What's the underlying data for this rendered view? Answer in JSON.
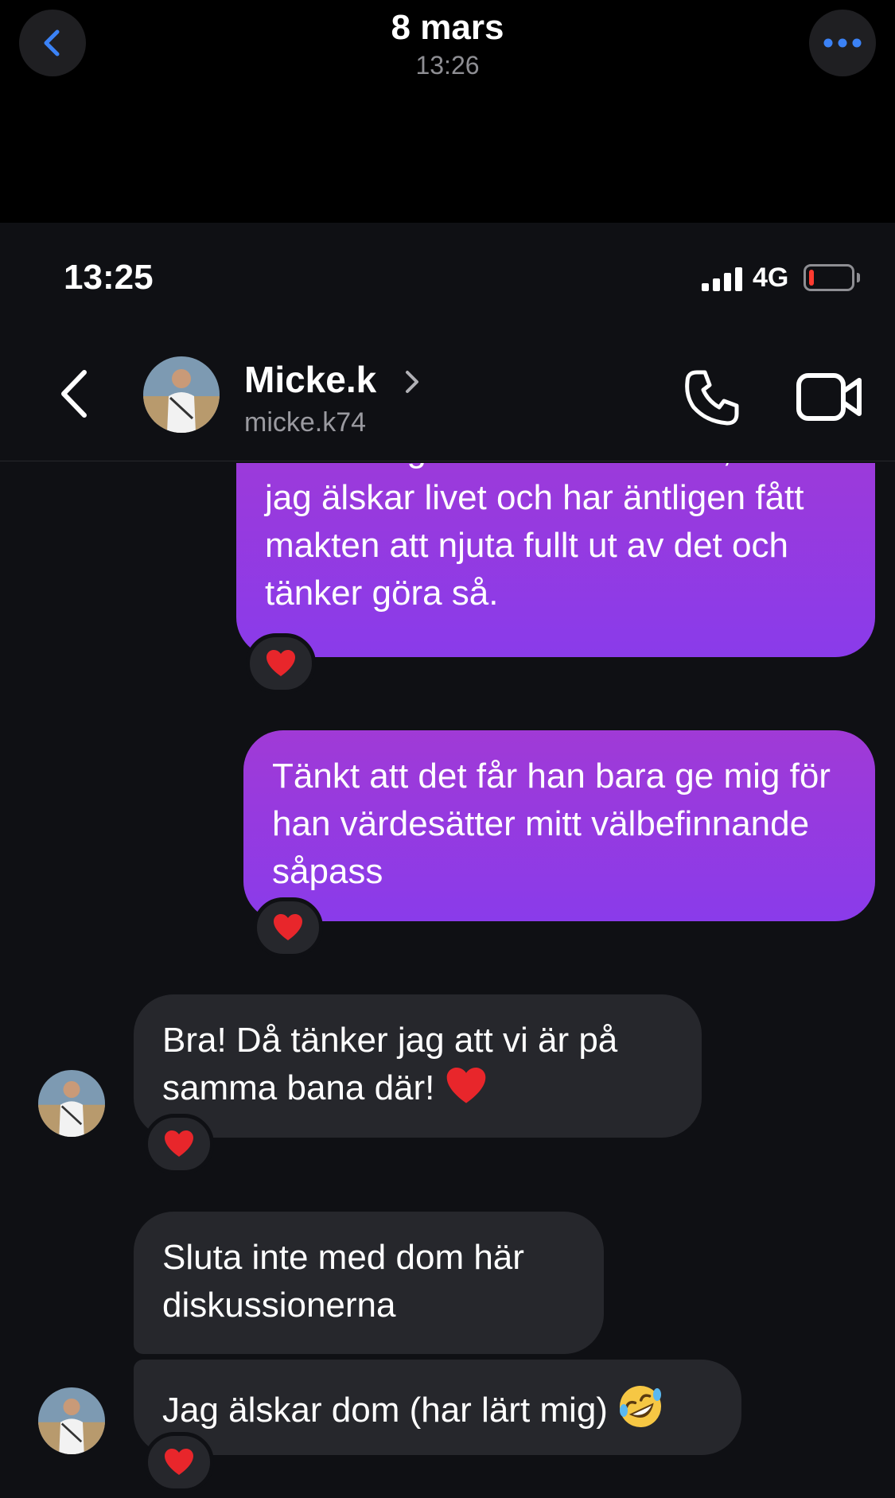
{
  "viewer": {
    "date": "8 mars",
    "time": "13:26",
    "back_icon": "chevron-left-icon",
    "more_icon": "ellipsis-icon"
  },
  "status_bar": {
    "time": "13:25",
    "network": "4G",
    "battery_level": 0.12
  },
  "chat_header": {
    "name": "Micke.k",
    "handle": "micke.k74"
  },
  "messages": [
    {
      "direction": "sent",
      "text": "omständigheter som situation, men jag älskar livet och har äntligen fått makten att njuta fullt ut av det och tänker göra så.",
      "reaction": "heart"
    },
    {
      "direction": "sent",
      "text": "Tänkt att det får han bara ge mig för han värdesätter mitt välbefinnande såpass",
      "reaction": "heart"
    },
    {
      "direction": "received",
      "text": "Bra! Då tänker jag att vi är på samma bana där!",
      "trailing_emoji": "red-heart",
      "reaction": "heart"
    },
    {
      "direction": "received",
      "text": "Sluta inte med dom här diskussionerna"
    },
    {
      "direction": "received",
      "text": "Jag älskar dom (har lärt mig)",
      "trailing_emoji": "rolling-on-floor-laughing",
      "reaction": "heart"
    }
  ],
  "colors": {
    "sent_bubble_top": "#a03ad6",
    "sent_bubble_bottom": "#8a3bea",
    "received_bubble": "#26272c",
    "background": "#0f1014",
    "accent_blue": "#3b82f6"
  }
}
